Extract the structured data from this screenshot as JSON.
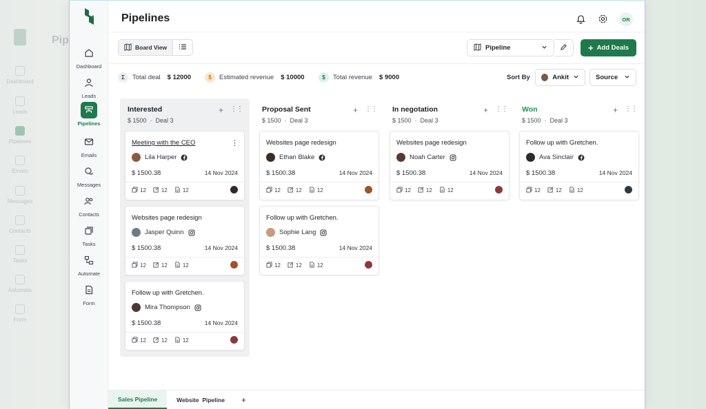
{
  "app": {
    "title": "Pipelines"
  },
  "nav": [
    {
      "label": "Dashboard",
      "icon": "home-icon"
    },
    {
      "label": "Leads",
      "icon": "user-icon"
    },
    {
      "label": "Pipelines",
      "icon": "pipeline-icon",
      "active": true
    },
    {
      "label": "Emails",
      "icon": "mail-icon"
    },
    {
      "label": "Messages",
      "icon": "chat-icon"
    },
    {
      "label": "Contacts",
      "icon": "contacts-icon"
    },
    {
      "label": "Tasks",
      "icon": "tasks-icon"
    },
    {
      "label": "Automate",
      "icon": "automate-icon"
    },
    {
      "label": "Form",
      "icon": "form-icon"
    }
  ],
  "header": {
    "avatar_initials": "OR"
  },
  "toolbar": {
    "board_view_label": "Board View",
    "pipeline_select": "Pipeline",
    "add_deals_label": "Add Deals"
  },
  "stats": {
    "total_deal_label": "Total deal",
    "total_deal_value": "$ 12000",
    "estimated_revenue_label": "Estimated revenue",
    "estimated_revenue_value": "$ 10000",
    "total_revenue_label": "Total revenue",
    "total_revenue_value": "$ 9000",
    "sort_by_label": "Sort By",
    "sort_owner": "Ankit",
    "sort_source": "Source"
  },
  "columns": [
    {
      "title": "Interested",
      "amount": "$ 1500",
      "deals": "Deal 3",
      "cards": [
        {
          "title": "Meeting with the CEO",
          "person": "Lila Harper",
          "social": "facebook",
          "amount": "$ 1500.38",
          "date": "14 Nov 2024",
          "c1": "12",
          "c2": "12",
          "c3": "12"
        },
        {
          "title": "Websites page redesign",
          "person": "Jasper Quinn",
          "social": "instagram",
          "amount": "$ 1500.38",
          "date": "14 Nov 2024",
          "c1": "12",
          "c2": "12",
          "c3": "12"
        },
        {
          "title": "Follow up with Gretchen.",
          "person": "Mira Thompson",
          "social": "instagram",
          "amount": "$ 1500.38",
          "date": "14 Nov 2024",
          "c1": "12",
          "c2": "12",
          "c3": "12"
        }
      ]
    },
    {
      "title": "Proposal Sent",
      "amount": "$ 1500",
      "deals": "Deal 3",
      "cards": [
        {
          "title": "Websites page redesign",
          "person": "Ethan Blake",
          "social": "facebook",
          "amount": "$ 1500.38",
          "date": "14 Nov 2024",
          "c1": "12",
          "c2": "12",
          "c3": "12"
        },
        {
          "title": "Follow up with Gretchen.",
          "person": "Sophie Lang",
          "social": "instagram",
          "amount": "$ 1500.38",
          "date": "14 Nov 2024",
          "c1": "12",
          "c2": "12",
          "c3": "12"
        }
      ]
    },
    {
      "title": "In negotation",
      "amount": "$ 1500",
      "deals": "Deal 3",
      "cards": [
        {
          "title": "Websites page redesign",
          "person": "Noah Carter",
          "social": "instagram",
          "amount": "$ 1500.38",
          "date": "14 Nov 2024",
          "c1": "12",
          "c2": "12",
          "c3": "12"
        }
      ]
    },
    {
      "title": "Won",
      "amount": "$ 1500",
      "deals": "Deal 3",
      "cards": [
        {
          "title": "Follow up with Gretchen.",
          "person": "Ava Sinclair",
          "social": "facebook",
          "amount": "$ 1500.38",
          "date": "14 Nov 2024",
          "c1": "12",
          "c2": "12",
          "c3": "12"
        }
      ]
    }
  ],
  "bottom_tabs": [
    "Sales Pipeline",
    "Website  Pipeline"
  ],
  "colors": {
    "accent": "#1e7a4c",
    "won": "#1e9450"
  }
}
